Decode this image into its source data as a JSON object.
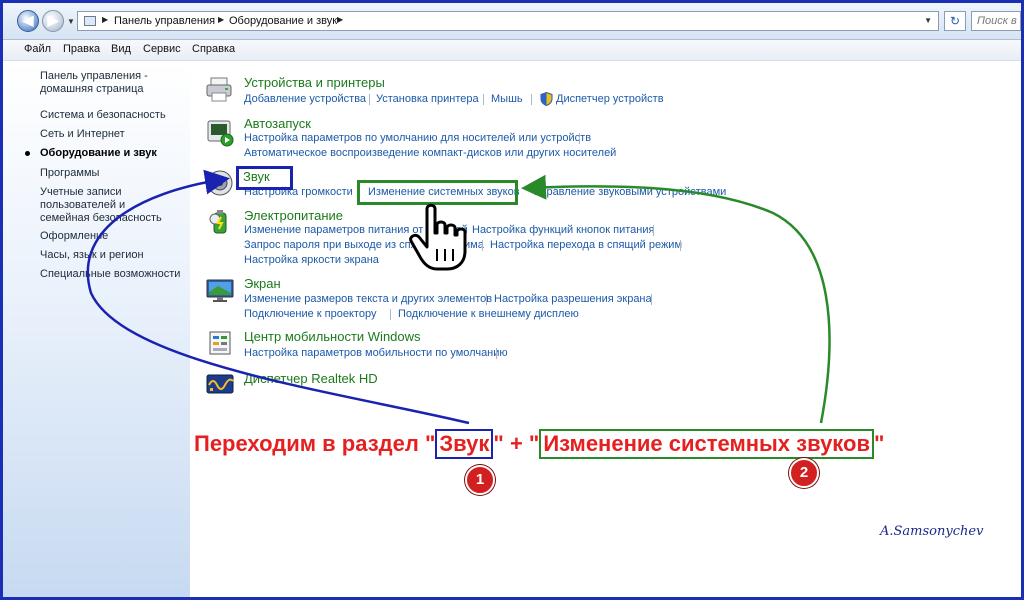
{
  "address_bar": {
    "breadcrumb": [
      "Панель управления",
      "Оборудование и звук"
    ],
    "search_placeholder": "Поиск в п"
  },
  "menu": [
    "Файл",
    "Правка",
    "Вид",
    "Сервис",
    "Справка"
  ],
  "sidebar": {
    "home": "Панель управления - домашняя страница",
    "items": [
      "Система и безопасность",
      "Сеть и Интернет",
      "Оборудование и звук",
      "Программы",
      "Учетные записи пользователей и семейная безопасность",
      "Оформление",
      "Часы, язык и регион",
      "Специальные возможности"
    ],
    "current_index": 2
  },
  "categories": [
    {
      "title": "Устройства и принтеры",
      "icon": "printer-icon",
      "links": [
        "Добавление устройства",
        "Установка принтера",
        "Мышь",
        "Диспетчер устройств"
      ]
    },
    {
      "title": "Автозапуск",
      "icon": "autoplay-icon",
      "links": [
        "Настройка параметров по умолчанию для носителей или устройств",
        "Автоматическое воспроизведение компакт-дисков или других носителей"
      ]
    },
    {
      "title": "Звук",
      "icon": "speaker-icon",
      "links": [
        "Настройка громкости",
        "Изменение системных звуков",
        "Управление звуковыми устройствами"
      ]
    },
    {
      "title": "Электропитание",
      "icon": "power-icon",
      "links": [
        "Изменение параметров питания от батарей",
        "Настройка функций кнопок питания",
        "Запрос пароля при выходе из спящего режима",
        "Настройка перехода в спящий режим",
        "Настройка яркости экрана"
      ]
    },
    {
      "title": "Экран",
      "icon": "display-icon",
      "links": [
        "Изменение размеров текста и других элементов",
        "Настройка разрешения экрана",
        "Подключение к проектору",
        "Подключение к внешнему дисплею"
      ]
    },
    {
      "title": "Центр мобильности Windows",
      "icon": "mobility-icon",
      "links": [
        "Настройка параметров мобильности по умолчанию"
      ]
    },
    {
      "title": "Диспетчер Realtek HD",
      "icon": "realtek-icon",
      "links": []
    }
  ],
  "annotation": {
    "instruction_part1": "Переходим в раздел \"",
    "instruction_highlight1": "Звук",
    "instruction_part2": "\" + \"",
    "instruction_highlight2": "Изменение системных звуков",
    "instruction_part3": "\"",
    "badge1": "1",
    "badge2": "2",
    "signature": "A.Samsonychev"
  },
  "colors": {
    "frame": "#1b2fb5",
    "category_title": "#1c7a1c",
    "task_link": "#1c5aa8",
    "annotation_red": "#e52020",
    "box_blue": "#1a22b0",
    "box_green": "#2a8a2a"
  }
}
